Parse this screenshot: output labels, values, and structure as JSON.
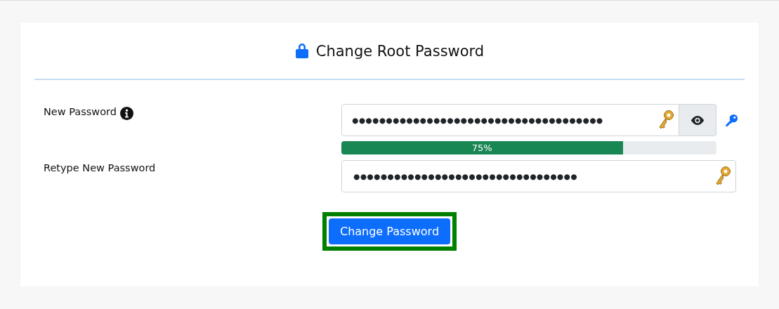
{
  "title": "Change Root Password",
  "fields": [
    {
      "kind": "new",
      "label": "New Password",
      "masked_value": "●●●●●●●●●●●●●●●●●●●●●●●●●●●●●●●●●●●●●",
      "strength": {
        "level": 0.75,
        "reading": "75%"
      }
    },
    {
      "kind": "retype",
      "label": "Retype New Password",
      "masked_value": "●●●●●●●●●●●●●●●●●●●●●●●●●●●●●●●●●"
    }
  ],
  "submit": {
    "label": "Change Password",
    "focused": true
  }
}
